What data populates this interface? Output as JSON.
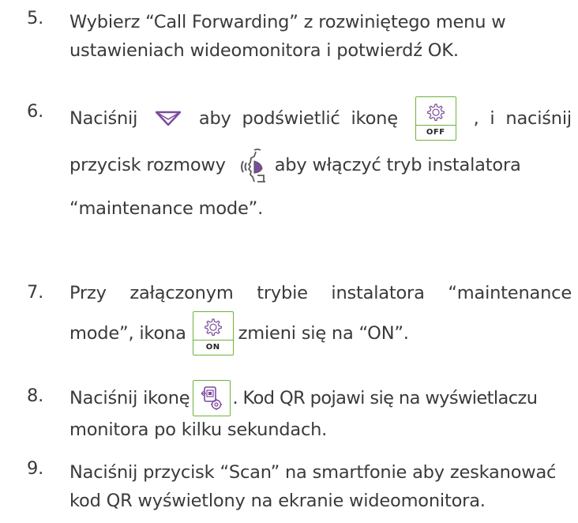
{
  "steps": [
    {
      "number": "5.",
      "lines": [
        "Wybierz  “Call Forwarding” z rozwiniętego menu w",
        "ustawieniach wideomonitora i potwierdź OK."
      ]
    },
    {
      "number": "6.",
      "line1_a": "Naciśnij",
      "line1_b": "aby  podświetlić  ikonę",
      "line1_c": ",  i  naciśnij",
      "line2_a": "przycisk rozmowy",
      "line2_b": "aby włączyć tryb instalatora",
      "line3": "“maintenance mode”.",
      "icon_label": "OFF"
    },
    {
      "number": "7.",
      "line1_words": [
        "Przy",
        "załączonym",
        "trybie",
        "instalatora",
        "“maintenance"
      ],
      "line2_a": "mode”, ikona",
      "line2_b": "zmieni się na “ON”.",
      "icon_label": "ON"
    },
    {
      "number": "8.",
      "line1_a": "Naciśnij ikonę",
      "line1_b": ". Kod QR pojawi się na wyświetlaczu",
      "line2": "monitora po kilku sekundach."
    },
    {
      "number": "9.",
      "lines": [
        "Naciśnij przycisk “Scan” na smartfonie aby zeskanować",
        "kod QR wyświetlony na ekranie wideomonitora."
      ]
    }
  ],
  "icons": {
    "down_arrow": "down-triangle-icon",
    "settings": "gear-icon",
    "talk": "talk-button-icon",
    "qr_settings": "qr-settings-icon"
  },
  "colors": {
    "text": "#3a3a3a",
    "accent": "#6fb23c",
    "icon_purple": "#7b4a9e"
  }
}
